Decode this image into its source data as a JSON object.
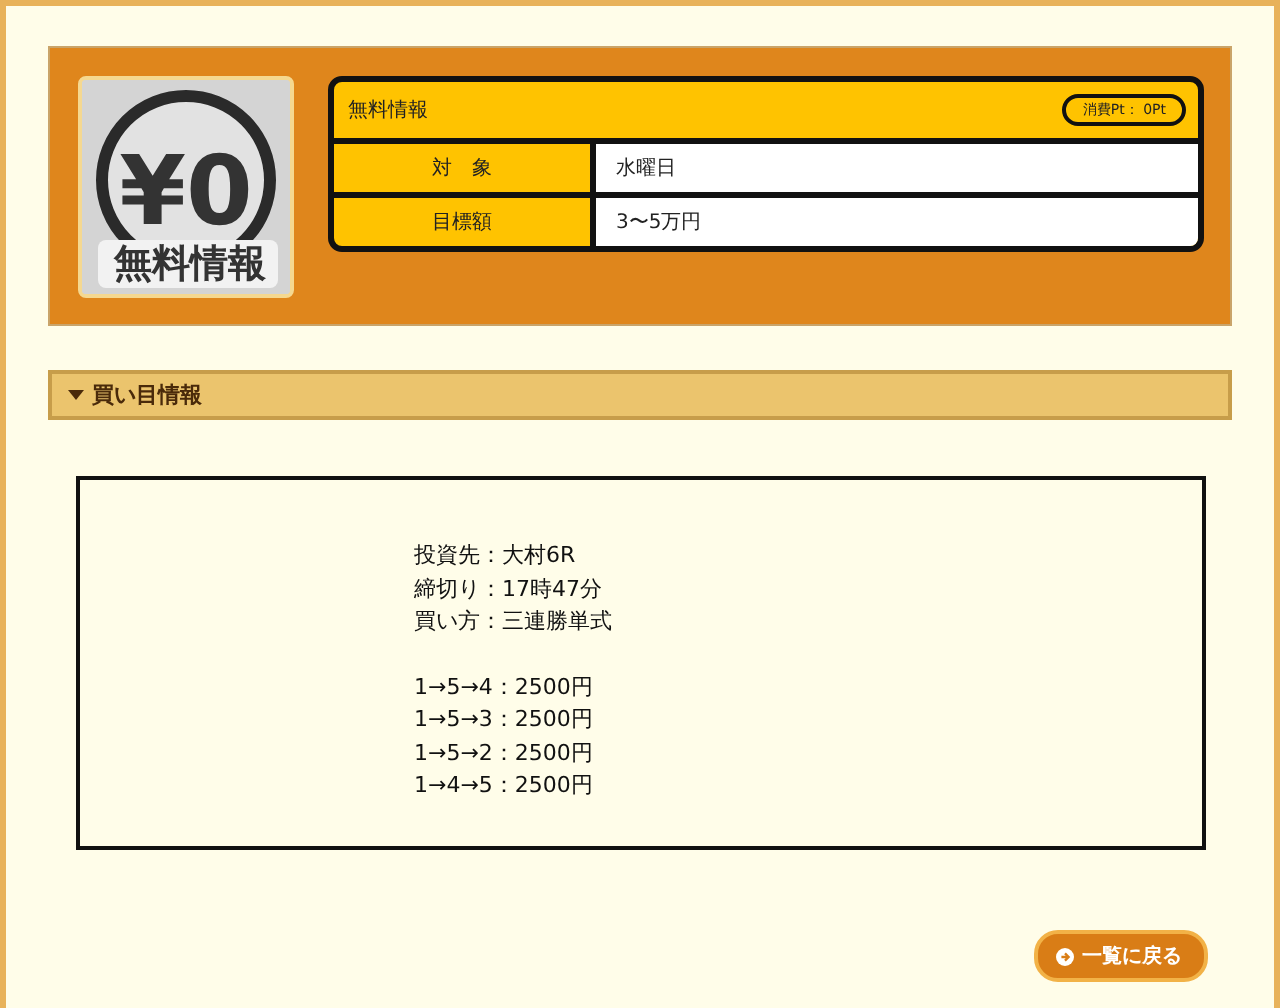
{
  "logo": {
    "amount": "¥0",
    "label": "無料情報"
  },
  "info": {
    "title": "無料情報",
    "cost_badge": "消費Pt： 0Pt",
    "rows": [
      {
        "label": "対　象",
        "value": "水曜日"
      },
      {
        "label": "目標額",
        "value": "3〜5万円"
      }
    ]
  },
  "section": {
    "title": "買い目情報",
    "expanded": true
  },
  "details": [
    "投資先：大村6R",
    "締切り：17時47分",
    "買い方：三連勝単式"
  ],
  "bets": [
    "1→5→4：2500円",
    "1→5→3：2500円",
    "1→5→2：2500円",
    "1→4→5：2500円"
  ],
  "back_button": "一覧に戻る"
}
